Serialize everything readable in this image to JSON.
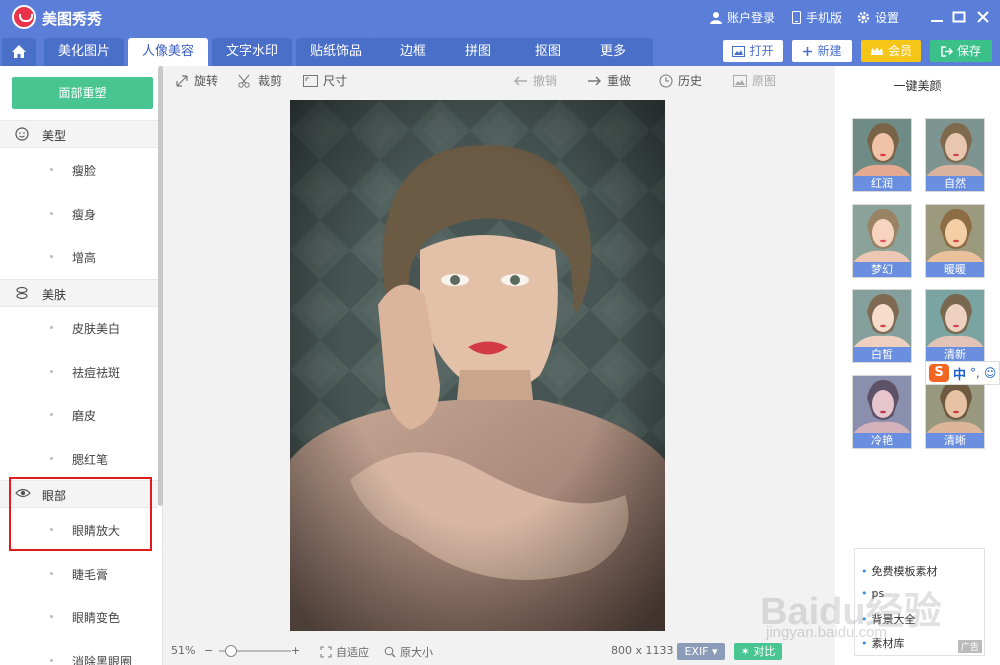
{
  "app": {
    "title": "美图秀秀"
  },
  "titlebar": {
    "account": "账户登录",
    "mobile": "手机版",
    "settings": "设置"
  },
  "nav": {
    "tabs": [
      "美化图片",
      "人像美容",
      "文字水印",
      "贴纸饰品",
      "边框",
      "拼图",
      "抠图",
      "更多"
    ],
    "active_tab": "人像美容",
    "open": "打开",
    "new": "新建",
    "vip": "会员",
    "save": "保存"
  },
  "left": {
    "reset_button": "面部重塑",
    "sections": [
      {
        "label": "美型",
        "items": [
          "瘦脸",
          "瘦身",
          "增高"
        ]
      },
      {
        "label": "美肤",
        "items": [
          "皮肤美白",
          "祛痘祛斑",
          "磨皮",
          "腮红笔"
        ]
      },
      {
        "label": "眼部",
        "items": [
          "眼睛放大",
          "睫毛膏",
          "眼睛变色",
          "消除黑眼圈"
        ]
      }
    ]
  },
  "toolbar": {
    "rotate": "旋转",
    "crop": "裁剪",
    "size": "尺寸",
    "undo": "撤销",
    "redo": "重做",
    "history": "历史",
    "original": "原图"
  },
  "status": {
    "zoom": "51%",
    "fit": "自适应",
    "actual": "原大小",
    "dimensions": "800 x 1133",
    "exif": "EXIF",
    "compare": "对比"
  },
  "right": {
    "title": "一键美颜",
    "presets": [
      "红润",
      "自然",
      "梦幻",
      "暖暖",
      "白皙",
      "清新",
      "冷艳",
      "清晰"
    ]
  },
  "ime": {
    "brand": "S",
    "lang": "中"
  },
  "ad": {
    "items": [
      "免费模板素材",
      "ps",
      "背景大全",
      "素材库"
    ],
    "tag": "广告"
  },
  "watermark": {
    "main": "Baidu经验",
    "sub": "jingyan.baidu.com"
  },
  "colors": {
    "header": "#5b7fd9",
    "green": "#49c592",
    "gold": "#f5c518",
    "highlight": "#e21b1b"
  }
}
